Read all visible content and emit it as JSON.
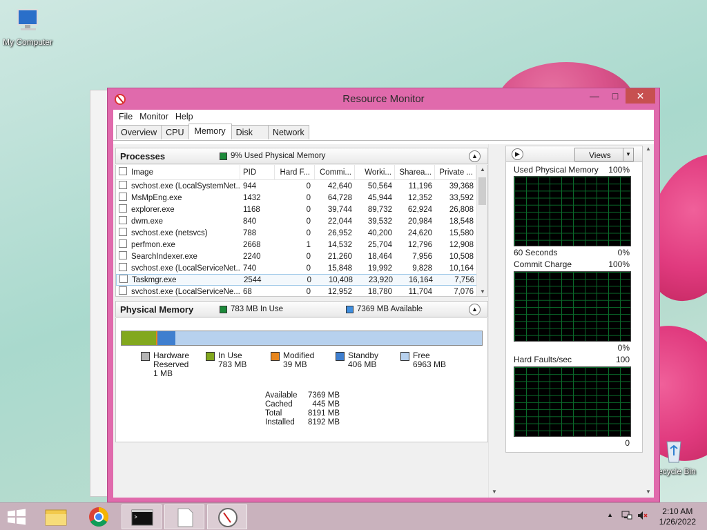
{
  "desktop": {
    "my_computer_label": "My Computer",
    "recycle_bin_label": "Recycle Bin"
  },
  "window": {
    "title": "Resource Monitor",
    "menu": [
      "File",
      "Monitor",
      "Help"
    ],
    "tabs": [
      "Overview",
      "CPU",
      "Memory",
      "Disk",
      "Network"
    ],
    "active_tab": "Memory"
  },
  "processes": {
    "title": "Processes",
    "info": "9% Used Physical Memory",
    "columns": [
      "Image",
      "PID",
      "Hard F...",
      "Commi...",
      "Worki...",
      "Sharea...",
      "Private ..."
    ],
    "rows": [
      {
        "image": "svchost.exe (LocalSystemNet...",
        "pid": "944",
        "hf": "0",
        "commit": "42,640",
        "working": "50,564",
        "share": "11,196",
        "private": "39,368"
      },
      {
        "image": "MsMpEng.exe",
        "pid": "1432",
        "hf": "0",
        "commit": "64,728",
        "working": "45,944",
        "share": "12,352",
        "private": "33,592"
      },
      {
        "image": "explorer.exe",
        "pid": "1168",
        "hf": "0",
        "commit": "39,744",
        "working": "89,732",
        "share": "62,924",
        "private": "26,808"
      },
      {
        "image": "dwm.exe",
        "pid": "840",
        "hf": "0",
        "commit": "22,044",
        "working": "39,532",
        "share": "20,984",
        "private": "18,548"
      },
      {
        "image": "svchost.exe (netsvcs)",
        "pid": "788",
        "hf": "0",
        "commit": "26,952",
        "working": "40,200",
        "share": "24,620",
        "private": "15,580"
      },
      {
        "image": "perfmon.exe",
        "pid": "2668",
        "hf": "1",
        "commit": "14,532",
        "working": "25,704",
        "share": "12,796",
        "private": "12,908"
      },
      {
        "image": "SearchIndexer.exe",
        "pid": "2240",
        "hf": "0",
        "commit": "21,260",
        "working": "18,464",
        "share": "7,956",
        "private": "10,508"
      },
      {
        "image": "svchost.exe (LocalServiceNet...",
        "pid": "740",
        "hf": "0",
        "commit": "15,848",
        "working": "19,992",
        "share": "9,828",
        "private": "10,164"
      },
      {
        "image": "Taskmgr.exe",
        "pid": "2544",
        "hf": "0",
        "commit": "10,408",
        "working": "23,920",
        "share": "16,164",
        "private": "7,756"
      },
      {
        "image": "svchost.exe (LocalServiceNe...",
        "pid": "68",
        "hf": "0",
        "commit": "12,952",
        "working": "18,780",
        "share": "11,704",
        "private": "7,076"
      }
    ]
  },
  "physical_memory": {
    "title": "Physical Memory",
    "in_use_info": "783 MB In Use",
    "available_info": "7369 MB Available",
    "bar_fractions": {
      "hardware_reserved": 0.0001,
      "in_use": 0.095,
      "modified": 0.005,
      "standby": 0.05,
      "free": 0.85
    },
    "legend": [
      {
        "name": "Hardware Reserved",
        "line1": "Hardware",
        "line2": "Reserved",
        "value": "1 MB",
        "color": "#b4b4b4"
      },
      {
        "name": "In Use",
        "line1": "In Use",
        "line2": "",
        "value": "783 MB",
        "color": "#82a81e"
      },
      {
        "name": "Modified",
        "line1": "Modified",
        "line2": "",
        "value": "39 MB",
        "color": "#e8861c"
      },
      {
        "name": "Standby",
        "line1": "Standby",
        "line2": "",
        "value": "406 MB",
        "color": "#3f7fcf"
      },
      {
        "name": "Free",
        "line1": "Free",
        "line2": "",
        "value": "6963 MB",
        "color": "#b7d1ee"
      }
    ],
    "stats": [
      {
        "key": "Available",
        "value": "7369 MB"
      },
      {
        "key": "Cached",
        "value": "445 MB"
      },
      {
        "key": "Total",
        "value": "8191 MB"
      },
      {
        "key": "Installed",
        "value": "8192 MB"
      }
    ]
  },
  "graphs_panel": {
    "views_label": "Views",
    "graphs": [
      {
        "label": "Used Physical Memory",
        "max": "100%",
        "footer_left": "60 Seconds",
        "footer_right": "0%"
      },
      {
        "label": "Commit Charge",
        "max": "100%",
        "footer_left": "",
        "footer_right": "0%"
      },
      {
        "label": "Hard Faults/sec",
        "max": "100",
        "footer_left": "",
        "footer_right": "0"
      }
    ]
  },
  "taskbar": {
    "time": "2:10 AM",
    "date": "1/26/2022"
  }
}
